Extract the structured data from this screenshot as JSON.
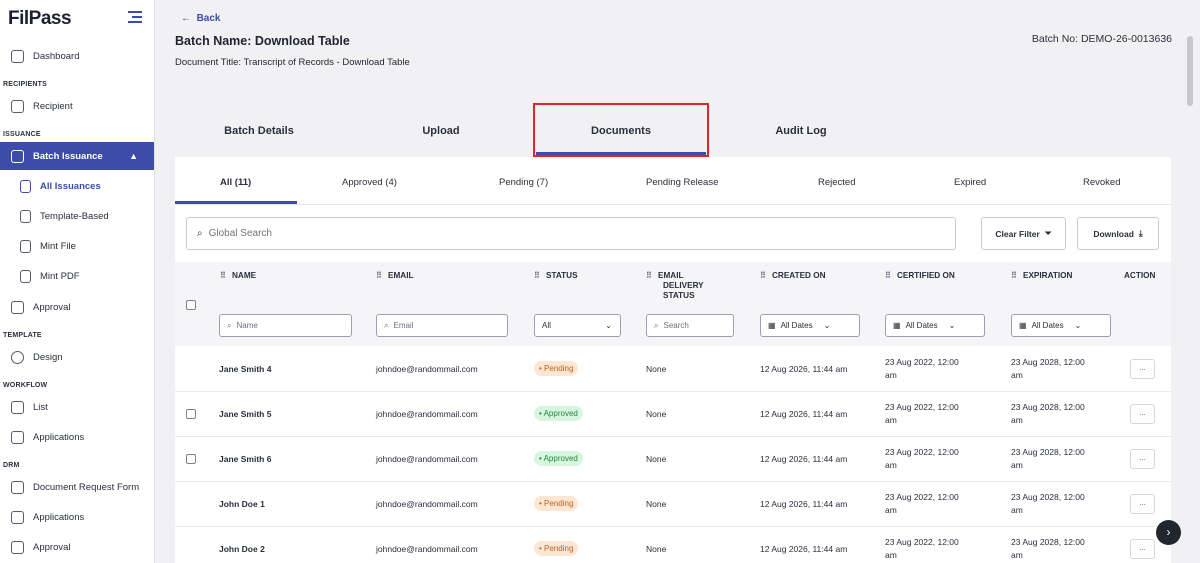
{
  "brand": {
    "logo_text": "FilPass"
  },
  "sidebar": {
    "dashboard": "Dashboard",
    "section_recipients": "RECIPIENTS",
    "recipient": "Recipient",
    "section_issuance": "ISSUANCE",
    "batch_issuance": "Batch Issuance",
    "all_issuances": "All Issuances",
    "template_based": "Template-Based",
    "mint_file": "Mint File",
    "mint_pdf": "Mint PDF",
    "approval": "Approval",
    "section_template": "TEMPLATE",
    "design": "Design",
    "section_workflow": "WORKFLOW",
    "list": "List",
    "applications": "Applications",
    "section_drm": "DRM",
    "document_request_form": "Document Request Form",
    "drm_applications": "Applications",
    "drm_approval": "Approval"
  },
  "header": {
    "back": "Back",
    "batch_name": "Batch Name: Download Table",
    "document_title": "Document Title: Transcript of Records - Download Table",
    "batch_no": "Batch No: DEMO-26-0013636"
  },
  "main_tabs": [
    "Batch Details",
    "Upload",
    "Documents",
    "Audit Log"
  ],
  "sub_tabs": [
    "All (11)",
    "Approved (4)",
    "Pending (7)",
    "Pending Release",
    "Rejected",
    "Expired",
    "Revoked"
  ],
  "search": {
    "placeholder": "Global Search"
  },
  "buttons": {
    "clear_filter": "Clear Filter",
    "download": "Download"
  },
  "table": {
    "headers": {
      "name": "NAME",
      "email": "EMAIL",
      "status": "STATUS",
      "email_delivery_1": "EMAIL",
      "email_delivery_2": "DELIVERY",
      "email_delivery_3": "STATUS",
      "created_on": "CREATED ON",
      "certified_on": "CERTIFIED ON",
      "expiration": "EXPIRATION",
      "action": "ACTION"
    },
    "filters": {
      "name_placeholder": "Name",
      "email_placeholder": "Email",
      "status_value": "All",
      "delivery_placeholder": "Search",
      "created_value": "All Dates",
      "certified_value": "All Dates",
      "expiration_value": "All Dates"
    },
    "rows": [
      {
        "name": "Jane Smith 4",
        "email": "johndoe@randommail.com",
        "status": "Pending",
        "delivery": "None",
        "created": "12 Aug 2026, 11:44 am",
        "certified_1": "23 Aug 2022, 12:00",
        "certified_2": "am",
        "expiration_1": "23 Aug 2028, 12:00",
        "expiration_2": "am",
        "action": "..."
      },
      {
        "name": "Jane Smith 5",
        "email": "johndoe@randommail.com",
        "status": "Approved",
        "delivery": "None",
        "created": "12 Aug 2026, 11:44 am",
        "certified_1": "23 Aug 2022, 12:00",
        "certified_2": "am",
        "expiration_1": "23 Aug 2028, 12:00",
        "expiration_2": "am",
        "action": "..."
      },
      {
        "name": "Jane Smith 6",
        "email": "johndoe@randommail.com",
        "status": "Approved",
        "delivery": "None",
        "created": "12 Aug 2026, 11:44 am",
        "certified_1": "23 Aug 2022, 12:00",
        "certified_2": "am",
        "expiration_1": "23 Aug 2028, 12:00",
        "expiration_2": "am",
        "action": "..."
      },
      {
        "name": "John Doe 1",
        "email": "johndoe@randommail.com",
        "status": "Pending",
        "delivery": "None",
        "created": "12 Aug 2026, 11:44 am",
        "certified_1": "23 Aug 2022, 12:00",
        "certified_2": "am",
        "expiration_1": "23 Aug 2028, 12:00",
        "expiration_2": "am",
        "action": "..."
      },
      {
        "name": "John Doe 2",
        "email": "johndoe@randommail.com",
        "status": "Pending",
        "delivery": "None",
        "created": "12 Aug 2026, 11:44 am",
        "certified_1": "23 Aug 2022, 12:00",
        "certified_2": "am",
        "expiration_1": "23 Aug 2028, 12:00",
        "expiration_2": "am",
        "action": "..."
      }
    ]
  },
  "colors": {
    "accent": "#3d4ca6",
    "highlight_box": "#e0242c",
    "pending": "#b5641b",
    "approved": "#25893f"
  }
}
